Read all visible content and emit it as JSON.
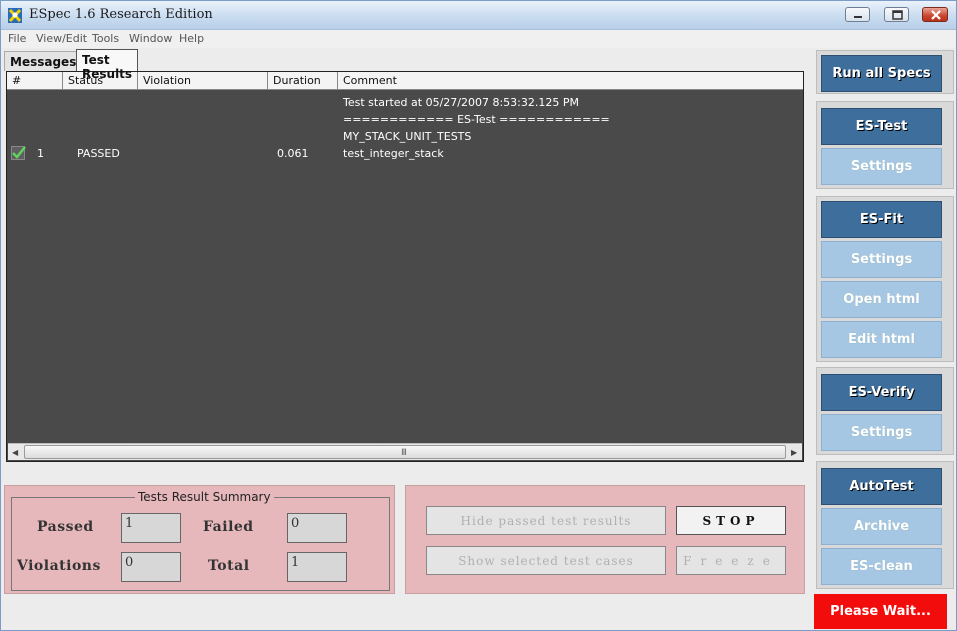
{
  "window": {
    "title": "ESpec 1.6 Research Edition"
  },
  "menu": [
    "File",
    "View/Edit",
    "Tools",
    "Window",
    "Help"
  ],
  "tabs": [
    {
      "label": "Messages",
      "active": false
    },
    {
      "label": "Test Results",
      "active": true
    }
  ],
  "table": {
    "columns": [
      "#",
      "Status",
      "Violation",
      "Duration",
      "Comment"
    ],
    "comment_lines": [
      "Test started at 05/27/2007 8:53:32.125 PM",
      "============ ES-Test ============",
      "MY_STACK_UNIT_TESTS"
    ],
    "rows": [
      {
        "num": "1",
        "status": "PASSED",
        "violation": "",
        "duration": "0.061",
        "comment": "test_integer_stack",
        "icon": "check-icon"
      }
    ],
    "scroll_grip": "III"
  },
  "summary": {
    "title": "Tests Result Summary",
    "passed_label": "Passed",
    "passed": "1",
    "failed_label": "Failed",
    "failed": "0",
    "violations_label": "Violations",
    "violations": "0",
    "total_label": "Total",
    "total": "1"
  },
  "controls": {
    "hide_passed": "Hide passed test results",
    "show_selected": "Show selected test cases",
    "stop": "STOP",
    "freeze": "Freeze"
  },
  "sidebar": {
    "run_all": "Run all Specs",
    "es_test": "ES-Test",
    "es_test_settings": "Settings",
    "es_fit": "ES-Fit",
    "es_fit_settings": "Settings",
    "open_html": "Open html",
    "edit_html": "Edit html",
    "es_verify": "ES-Verify",
    "es_verify_settings": "Settings",
    "autotest": "AutoTest",
    "archive": "Archive",
    "es_clean": "ES-clean",
    "status": "Please Wait..."
  },
  "colors": {
    "accent_dark": "#3e6e9c",
    "accent_light": "#a6c7e3",
    "panel_pink": "#e6b8bb",
    "results_bg": "#4a4a4a",
    "wait_red": "#f20c0c"
  }
}
